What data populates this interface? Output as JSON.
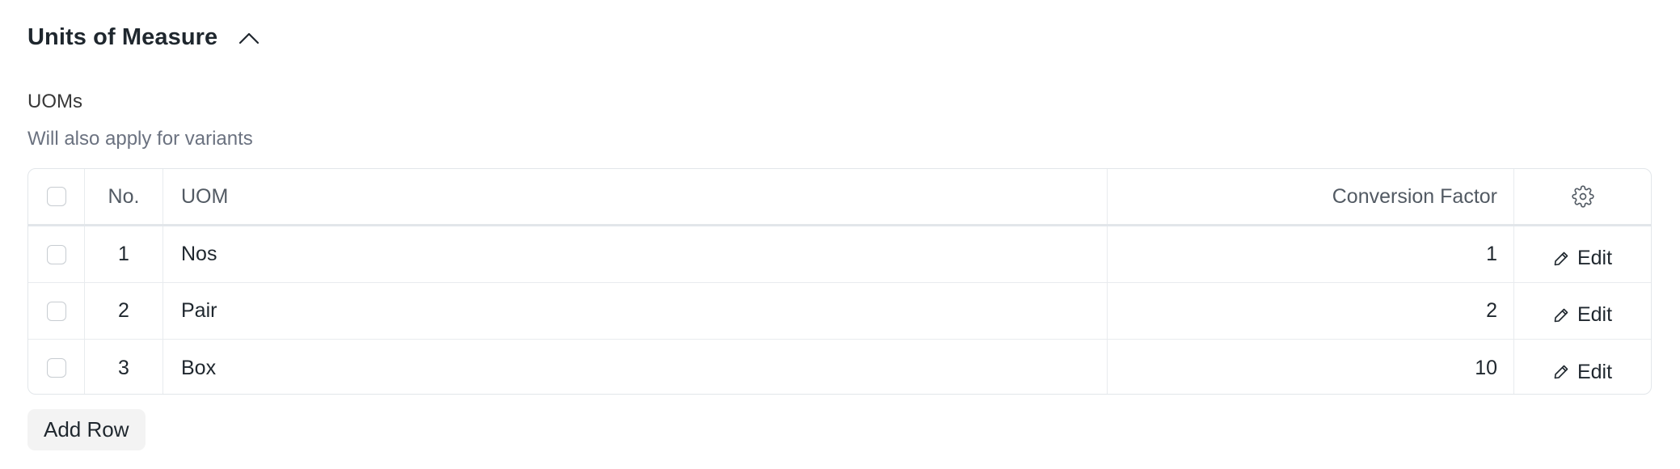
{
  "section": {
    "title": "Units of Measure",
    "collapse_icon": "chevron-up-icon"
  },
  "field": {
    "label": "UOMs",
    "description": "Will also apply for variants"
  },
  "table": {
    "columns": {
      "no": "No.",
      "uom": "UOM",
      "conversion_factor": "Conversion Factor",
      "settings_icon": "gear-icon"
    },
    "rows": [
      {
        "no": "1",
        "uom": "Nos",
        "conversion_factor": "1",
        "action": "Edit"
      },
      {
        "no": "2",
        "uom": "Pair",
        "conversion_factor": "2",
        "action": "Edit"
      },
      {
        "no": "3",
        "uom": "Box",
        "conversion_factor": "10",
        "action": "Edit"
      }
    ]
  },
  "add_row_label": "Add Row",
  "colors": {
    "text": "#1f272e",
    "muted": "#6b7280",
    "border": "#e2e6ea",
    "button_bg": "#f3f3f3"
  }
}
